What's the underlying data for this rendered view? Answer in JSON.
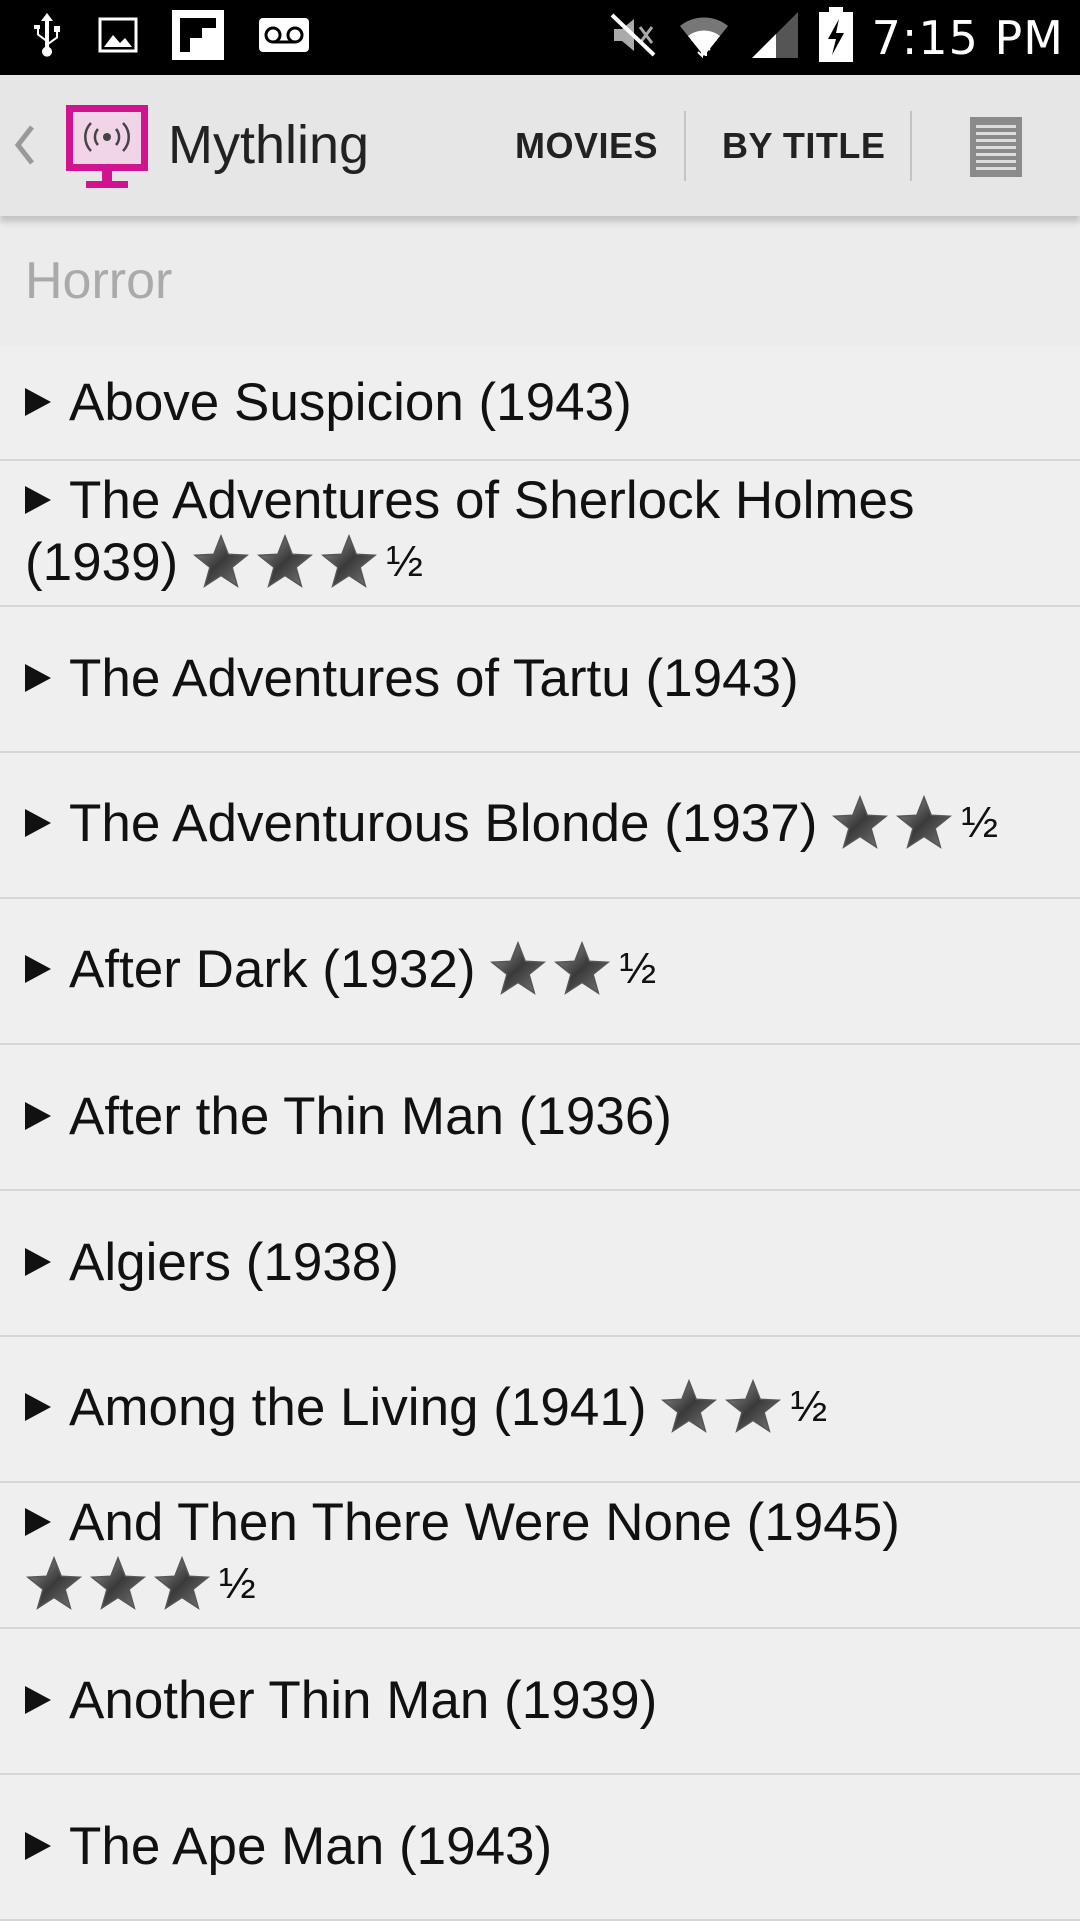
{
  "status_bar": {
    "time": "7:15 PM",
    "left_icons": [
      "usb-icon",
      "image-icon",
      "flipboard-icon",
      "voicemail-icon"
    ],
    "right_icons": [
      "mute-icon",
      "wifi-icon",
      "signal-icon",
      "battery-charging-icon"
    ]
  },
  "action_bar": {
    "title": "Mythling",
    "tabs": [
      "MOVIES",
      "BY TITLE"
    ],
    "accent_color": "#d0148f"
  },
  "list": {
    "section_header": "Horror",
    "items": [
      {
        "title": "Above Suspicion (1943)",
        "rating": ""
      },
      {
        "title": "The Adventures of Sherlock Holmes",
        "title_cont": "(1939)",
        "rating": "3.5"
      },
      {
        "title": "The Adventures of Tartu (1943)",
        "rating": ""
      },
      {
        "title": "The Adventurous Blonde (1937)",
        "rating": "2.5"
      },
      {
        "title": "After Dark (1932)",
        "rating": "2.5"
      },
      {
        "title": "After the Thin Man (1936)",
        "rating": ""
      },
      {
        "title": "Algiers (1938)",
        "rating": ""
      },
      {
        "title": "Among the Living (1941)",
        "rating": "2.5"
      },
      {
        "title": "And Then There Were None (1945)",
        "title_cont": "",
        "rating": "3.5"
      },
      {
        "title": "Another Thin Man (1939)",
        "rating": ""
      },
      {
        "title": "The Ape Man (1943)",
        "rating": ""
      }
    ],
    "half_symbol": "½"
  }
}
